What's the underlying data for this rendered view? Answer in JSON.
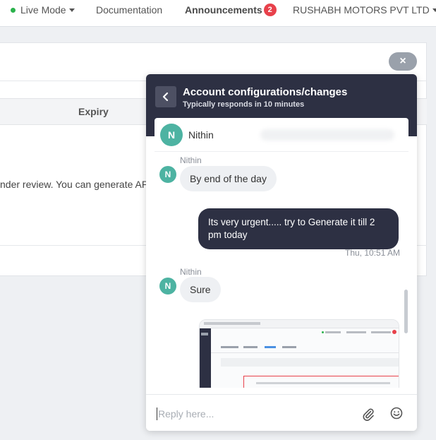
{
  "nav": {
    "mode_label": "Live Mode",
    "documentation": "Documentation",
    "announcements": "Announcements",
    "announcements_count": "2",
    "company": "RUSHABH MOTORS PVT LTD"
  },
  "background": {
    "expiry_header": "Expiry",
    "review_text": "nder review. You can generate API"
  },
  "close_label": "×",
  "widget": {
    "title": "Account configurations/changes",
    "subtitle": "Typically responds in 10 minutes",
    "agent_initial": "N",
    "agent_name": "Nithin",
    "messages": [
      {
        "sender": "Nithin",
        "initial": "N",
        "text": "By end of the day"
      },
      {
        "text": "Its very urgent..... try to Generate it till 2 pm today",
        "timestamp": "Thu, 10:51 AM"
      },
      {
        "sender": "Nithin",
        "initial": "N",
        "text": "Sure"
      }
    ],
    "reply_placeholder": "Reply here..."
  },
  "icons": [
    "chevron-left-icon",
    "paperclip-icon",
    "smiley-icon",
    "close-icon",
    "caret-down-icon"
  ],
  "colors": {
    "header_bg": "#2d3043",
    "avatar": "#4db3a2",
    "badge": "#e8414b",
    "live_dot": "#2bb24c"
  }
}
